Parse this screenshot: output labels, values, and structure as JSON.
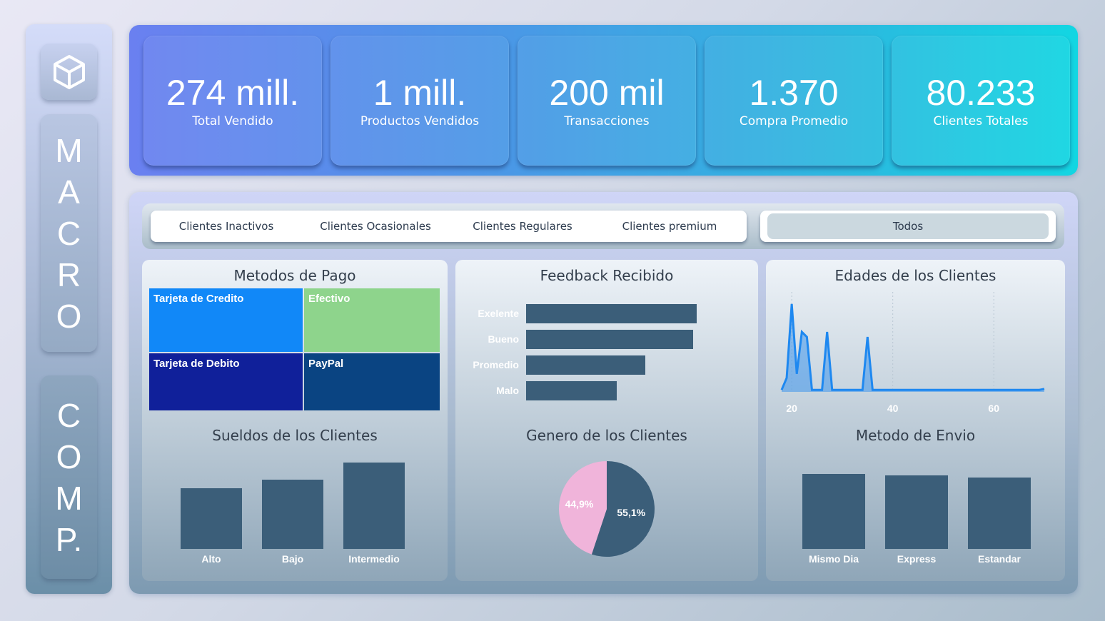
{
  "sidebar": {
    "logo_icon": "cube-icon",
    "word1": [
      "M",
      "A",
      "C",
      "R",
      "O"
    ],
    "word2": [
      "C",
      "O",
      "M",
      "P."
    ]
  },
  "kpis": [
    {
      "value": "274 mill.",
      "label": "Total Vendido"
    },
    {
      "value": "1 mill.",
      "label": "Productos Vendidos"
    },
    {
      "value": "200 mil",
      "label": "Transacciones"
    },
    {
      "value": "1.370",
      "label": "Compra Promedio"
    },
    {
      "value": "80.233",
      "label": "Clientes Totales"
    }
  ],
  "segments": {
    "options": [
      "Clientes Inactivos",
      "Clientes Ocasionales",
      "Clientes Regulares",
      "Clientes premium"
    ],
    "all_label": "Todos",
    "selected": "Todos"
  },
  "colors": {
    "bar": "#3b5e79",
    "female": "#f0b4da",
    "male": "#3b5e79",
    "line": "#1e88f0",
    "tile_credit": "#1188f8",
    "tile_cash": "#8ed48c",
    "tile_debit": "#10209a",
    "tile_paypal": "#0a4482"
  },
  "cards": {
    "payment_title": "Metodos de Pago",
    "feedback_title": "Feedback Recibido",
    "ages_title": "Edades de los Clientes",
    "salaries_title": "Sueldos de los Clientes",
    "gender_title": "Genero de los Clientes",
    "shipping_title": "Metodo de Envio"
  },
  "chart_data": [
    {
      "type": "treemap",
      "title": "Metodos de Pago",
      "categories": [
        "Tarjeta de Credito",
        "Efectivo",
        "Tarjeta de Debito",
        "PayPal"
      ]
    },
    {
      "type": "bar",
      "orientation": "horizontal",
      "title": "Feedback Recibido",
      "categories": [
        "Exelente",
        "Bueno",
        "Promedio",
        "Malo"
      ],
      "values": [
        100,
        98,
        70,
        53
      ]
    },
    {
      "type": "area",
      "title": "Edades de los Clientes",
      "xticks": [
        20,
        40,
        60
      ],
      "xlim": [
        18,
        70
      ],
      "x": [
        18,
        19,
        20,
        21,
        22,
        23,
        24,
        25,
        26,
        27,
        28,
        29,
        30,
        31,
        32,
        33,
        34,
        35,
        36,
        37,
        38,
        39,
        40,
        41,
        42,
        43,
        44,
        45,
        46,
        47,
        48,
        49,
        50,
        51,
        52,
        53,
        54,
        55,
        56,
        57,
        58,
        59,
        60,
        61,
        62,
        63,
        64,
        65,
        66,
        67,
        68,
        69,
        70
      ],
      "y": [
        2,
        14,
        88,
        18,
        60,
        55,
        2,
        2,
        2,
        60,
        2,
        2,
        2,
        2,
        2,
        2,
        2,
        55,
        2,
        2,
        2,
        2,
        2,
        2,
        2,
        2,
        2,
        2,
        2,
        2,
        2,
        2,
        2,
        2,
        2,
        2,
        2,
        2,
        2,
        2,
        2,
        2,
        2,
        2,
        2,
        2,
        2,
        2,
        2,
        2,
        2,
        2,
        3
      ]
    },
    {
      "type": "bar",
      "title": "Sueldos de los Clientes",
      "categories": [
        "Alto",
        "Bajo",
        "Intermedio"
      ],
      "values": [
        70,
        80,
        100
      ]
    },
    {
      "type": "pie",
      "title": "Genero de los Clientes",
      "slices": [
        {
          "label": "55,1%",
          "value": 55.1
        },
        {
          "label": "44,9%",
          "value": 44.9
        }
      ]
    },
    {
      "type": "bar",
      "title": "Metodo de Envio",
      "categories": [
        "Mismo Dia",
        "Express",
        "Estandar"
      ],
      "values": [
        100,
        98,
        95
      ]
    }
  ]
}
